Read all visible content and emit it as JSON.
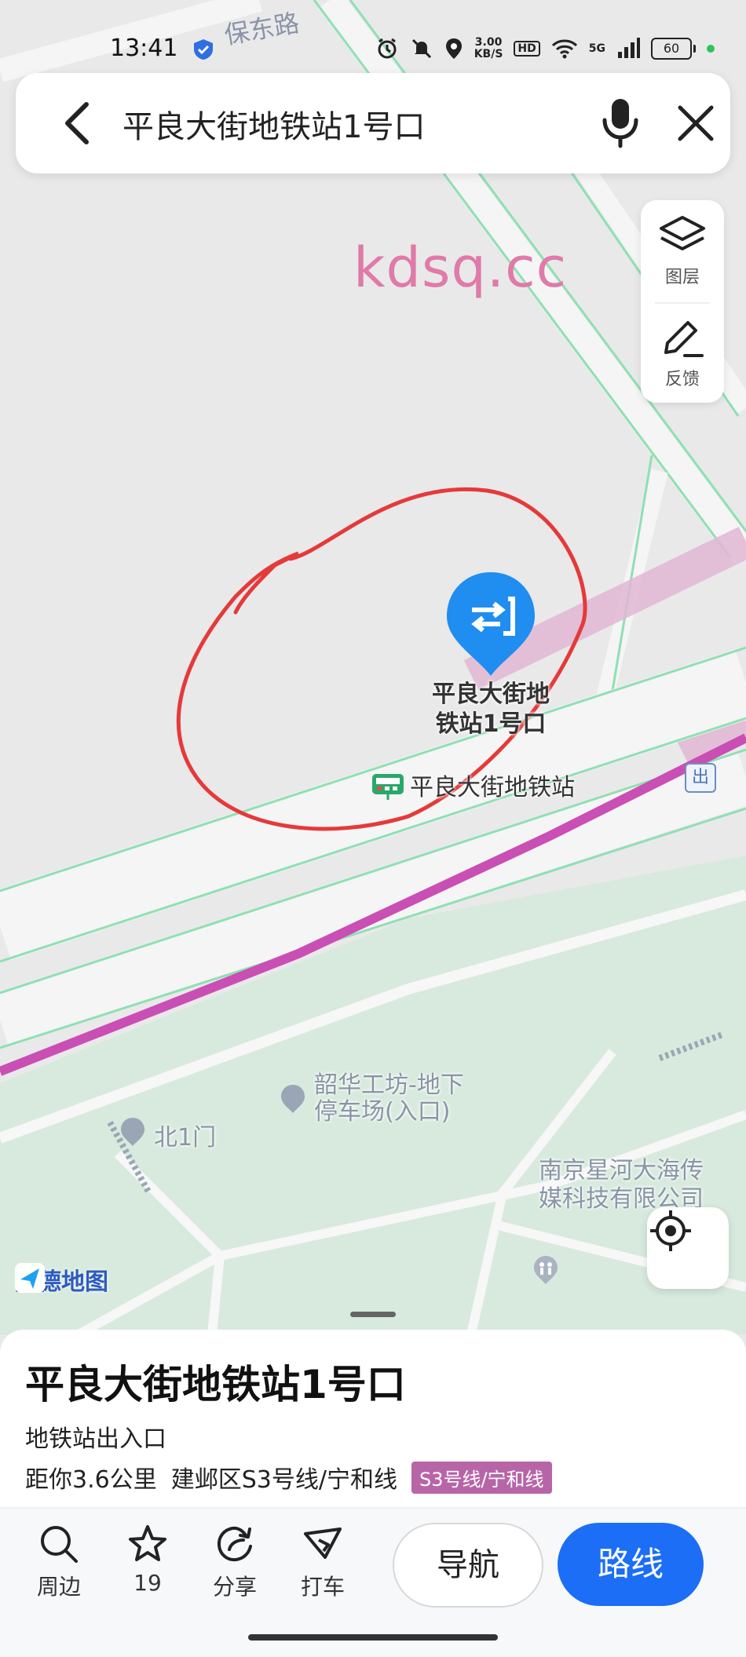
{
  "status_bar": {
    "time": "13:41",
    "net_speed_value": "3.00",
    "net_speed_unit": "KB/S",
    "hd": "HD",
    "signal_type": "5G",
    "battery": "60",
    "icons": [
      "shield-icon",
      "alarm-icon",
      "mute-icon",
      "location-icon",
      "wifi-icon",
      "signal-icon",
      "battery-icon"
    ]
  },
  "search": {
    "query": "平良大街地铁站1号口",
    "icons": [
      "back-arrow-icon",
      "microphone-icon",
      "close-icon"
    ]
  },
  "side_panel": {
    "layers_label": "图层",
    "feedback_label": "反馈"
  },
  "watermark": "kdsq.cc",
  "map": {
    "road_label": "保东路",
    "pin_label_line1": "平良大街地",
    "pin_label_line2": "铁站1号口",
    "station_label": "平良大街地铁站",
    "exit_badge": "出",
    "poi_1_line1": "韶华工坊-地下",
    "poi_1_line2": "停车场(入口)",
    "poi_2": "北1门",
    "poi_3_line1": "南京星河大海传",
    "poi_3_line2": "媒科技有限公司",
    "brand": "高德地图",
    "colors": {
      "metro_line": "#c94fb4",
      "road_green": "#8fe0b2",
      "park": "#d7eadd",
      "pin": "#1f8ef0"
    }
  },
  "sheet": {
    "title": "平良大街地铁站1号口",
    "type": "地铁站出入口",
    "distance": "距你3.6公里",
    "district_line": "建邺区S3号线/宁和线",
    "line_tag": "S3号线/宁和线"
  },
  "actions": {
    "nearby": "周边",
    "favorites_count": "19",
    "share": "分享",
    "taxi": "打车",
    "navigate": "导航",
    "route": "路线"
  }
}
